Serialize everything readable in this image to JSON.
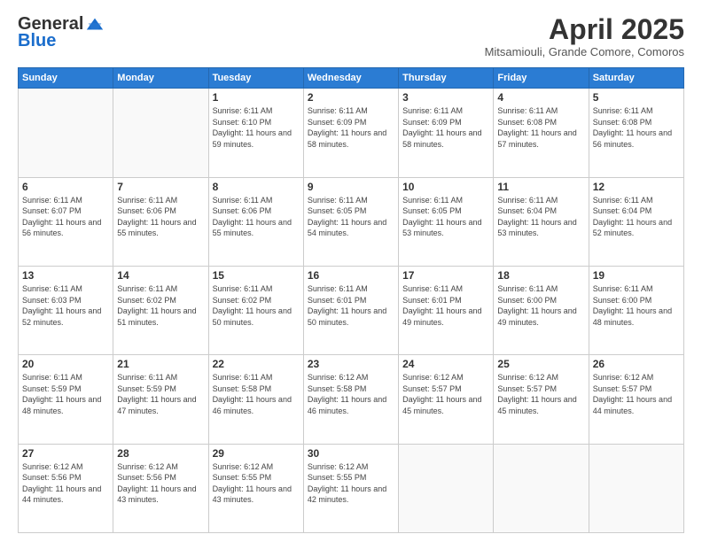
{
  "header": {
    "logo_line1": "General",
    "logo_line2": "Blue",
    "month": "April 2025",
    "location": "Mitsamiouli, Grande Comore, Comoros"
  },
  "days_of_week": [
    "Sunday",
    "Monday",
    "Tuesday",
    "Wednesday",
    "Thursday",
    "Friday",
    "Saturday"
  ],
  "weeks": [
    [
      {
        "day": "",
        "info": ""
      },
      {
        "day": "",
        "info": ""
      },
      {
        "day": "1",
        "info": "Sunrise: 6:11 AM\nSunset: 6:10 PM\nDaylight: 11 hours and 59 minutes."
      },
      {
        "day": "2",
        "info": "Sunrise: 6:11 AM\nSunset: 6:09 PM\nDaylight: 11 hours and 58 minutes."
      },
      {
        "day": "3",
        "info": "Sunrise: 6:11 AM\nSunset: 6:09 PM\nDaylight: 11 hours and 58 minutes."
      },
      {
        "day": "4",
        "info": "Sunrise: 6:11 AM\nSunset: 6:08 PM\nDaylight: 11 hours and 57 minutes."
      },
      {
        "day": "5",
        "info": "Sunrise: 6:11 AM\nSunset: 6:08 PM\nDaylight: 11 hours and 56 minutes."
      }
    ],
    [
      {
        "day": "6",
        "info": "Sunrise: 6:11 AM\nSunset: 6:07 PM\nDaylight: 11 hours and 56 minutes."
      },
      {
        "day": "7",
        "info": "Sunrise: 6:11 AM\nSunset: 6:06 PM\nDaylight: 11 hours and 55 minutes."
      },
      {
        "day": "8",
        "info": "Sunrise: 6:11 AM\nSunset: 6:06 PM\nDaylight: 11 hours and 55 minutes."
      },
      {
        "day": "9",
        "info": "Sunrise: 6:11 AM\nSunset: 6:05 PM\nDaylight: 11 hours and 54 minutes."
      },
      {
        "day": "10",
        "info": "Sunrise: 6:11 AM\nSunset: 6:05 PM\nDaylight: 11 hours and 53 minutes."
      },
      {
        "day": "11",
        "info": "Sunrise: 6:11 AM\nSunset: 6:04 PM\nDaylight: 11 hours and 53 minutes."
      },
      {
        "day": "12",
        "info": "Sunrise: 6:11 AM\nSunset: 6:04 PM\nDaylight: 11 hours and 52 minutes."
      }
    ],
    [
      {
        "day": "13",
        "info": "Sunrise: 6:11 AM\nSunset: 6:03 PM\nDaylight: 11 hours and 52 minutes."
      },
      {
        "day": "14",
        "info": "Sunrise: 6:11 AM\nSunset: 6:02 PM\nDaylight: 11 hours and 51 minutes."
      },
      {
        "day": "15",
        "info": "Sunrise: 6:11 AM\nSunset: 6:02 PM\nDaylight: 11 hours and 50 minutes."
      },
      {
        "day": "16",
        "info": "Sunrise: 6:11 AM\nSunset: 6:01 PM\nDaylight: 11 hours and 50 minutes."
      },
      {
        "day": "17",
        "info": "Sunrise: 6:11 AM\nSunset: 6:01 PM\nDaylight: 11 hours and 49 minutes."
      },
      {
        "day": "18",
        "info": "Sunrise: 6:11 AM\nSunset: 6:00 PM\nDaylight: 11 hours and 49 minutes."
      },
      {
        "day": "19",
        "info": "Sunrise: 6:11 AM\nSunset: 6:00 PM\nDaylight: 11 hours and 48 minutes."
      }
    ],
    [
      {
        "day": "20",
        "info": "Sunrise: 6:11 AM\nSunset: 5:59 PM\nDaylight: 11 hours and 48 minutes."
      },
      {
        "day": "21",
        "info": "Sunrise: 6:11 AM\nSunset: 5:59 PM\nDaylight: 11 hours and 47 minutes."
      },
      {
        "day": "22",
        "info": "Sunrise: 6:11 AM\nSunset: 5:58 PM\nDaylight: 11 hours and 46 minutes."
      },
      {
        "day": "23",
        "info": "Sunrise: 6:12 AM\nSunset: 5:58 PM\nDaylight: 11 hours and 46 minutes."
      },
      {
        "day": "24",
        "info": "Sunrise: 6:12 AM\nSunset: 5:57 PM\nDaylight: 11 hours and 45 minutes."
      },
      {
        "day": "25",
        "info": "Sunrise: 6:12 AM\nSunset: 5:57 PM\nDaylight: 11 hours and 45 minutes."
      },
      {
        "day": "26",
        "info": "Sunrise: 6:12 AM\nSunset: 5:57 PM\nDaylight: 11 hours and 44 minutes."
      }
    ],
    [
      {
        "day": "27",
        "info": "Sunrise: 6:12 AM\nSunset: 5:56 PM\nDaylight: 11 hours and 44 minutes."
      },
      {
        "day": "28",
        "info": "Sunrise: 6:12 AM\nSunset: 5:56 PM\nDaylight: 11 hours and 43 minutes."
      },
      {
        "day": "29",
        "info": "Sunrise: 6:12 AM\nSunset: 5:55 PM\nDaylight: 11 hours and 43 minutes."
      },
      {
        "day": "30",
        "info": "Sunrise: 6:12 AM\nSunset: 5:55 PM\nDaylight: 11 hours and 42 minutes."
      },
      {
        "day": "",
        "info": ""
      },
      {
        "day": "",
        "info": ""
      },
      {
        "day": "",
        "info": ""
      }
    ]
  ]
}
